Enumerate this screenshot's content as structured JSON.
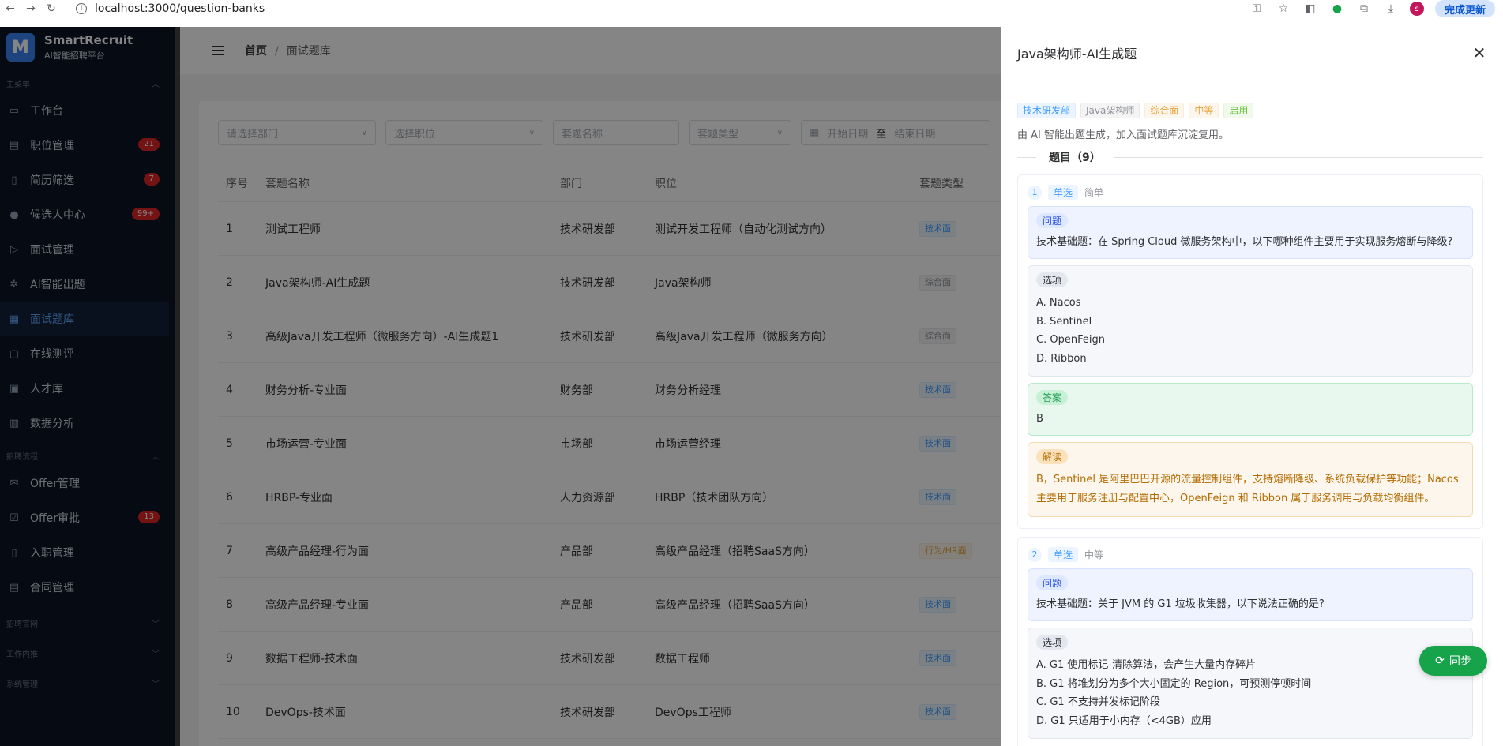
{
  "browser": {
    "url": "localhost:3000/question-banks",
    "update_label": "完成更新",
    "avatar_letter": "s"
  },
  "sidebar": {
    "brand": "SmartRecruit",
    "brand_sub": "AI智能招聘平台",
    "logo_letter": "M",
    "groups": [
      {
        "label": "主菜单"
      },
      {
        "label": "招聘流程"
      },
      {
        "label": "招聘官网"
      },
      {
        "label": "工作内推"
      },
      {
        "label": "系统管理"
      }
    ],
    "items": [
      {
        "label": "工作台",
        "badge": ""
      },
      {
        "label": "职位管理",
        "badge": "21"
      },
      {
        "label": "简历筛选",
        "badge": "7"
      },
      {
        "label": "候选人中心",
        "badge": "99+"
      },
      {
        "label": "面试管理",
        "badge": ""
      },
      {
        "label": "AI智能出题",
        "badge": ""
      },
      {
        "label": "面试题库",
        "badge": ""
      },
      {
        "label": "在线测评",
        "badge": ""
      },
      {
        "label": "人才库",
        "badge": ""
      },
      {
        "label": "数据分析",
        "badge": ""
      },
      {
        "label": "Offer管理",
        "badge": ""
      },
      {
        "label": "Offer审批",
        "badge": "13"
      },
      {
        "label": "入职管理",
        "badge": ""
      },
      {
        "label": "合同管理",
        "badge": ""
      }
    ]
  },
  "main": {
    "breadcrumb_home": "首页",
    "breadcrumb_current": "面试题库",
    "filters": {
      "department": "请选择部门",
      "position": "选择职位",
      "name": "套题名称",
      "type": "套题类型",
      "start_date": "开始日期",
      "to": "至",
      "end_date": "结束日期"
    },
    "columns": [
      "序号",
      "套题名称",
      "部门",
      "职位",
      "套题类型"
    ],
    "rows": [
      {
        "no": "1",
        "name": "测试工程师",
        "dept": "技术研发部",
        "position": "测试开发工程师（自动化测试方向）",
        "type": "技术面",
        "tone": "blue"
      },
      {
        "no": "2",
        "name": "Java架构师-AI生成题",
        "dept": "技术研发部",
        "position": "Java架构师",
        "type": "综合面",
        "tone": "gray"
      },
      {
        "no": "3",
        "name": "高级Java开发工程师（微服务方向）-AI生成题1",
        "dept": "技术研发部",
        "position": "高级Java开发工程师（微服务方向）",
        "type": "综合面",
        "tone": "gray"
      },
      {
        "no": "4",
        "name": "财务分析-专业面",
        "dept": "财务部",
        "position": "财务分析经理",
        "type": "技术面",
        "tone": "blue"
      },
      {
        "no": "5",
        "name": "市场运营-专业面",
        "dept": "市场部",
        "position": "市场运营经理",
        "type": "技术面",
        "tone": "blue"
      },
      {
        "no": "6",
        "name": "HRBP-专业面",
        "dept": "人力资源部",
        "position": "HRBP（技术团队方向）",
        "type": "技术面",
        "tone": "blue"
      },
      {
        "no": "7",
        "name": "高级产品经理-行为面",
        "dept": "产品部",
        "position": "高级产品经理（招聘SaaS方向）",
        "type": "行为/HR面",
        "tone": "orange"
      },
      {
        "no": "8",
        "name": "高级产品经理-专业面",
        "dept": "产品部",
        "position": "高级产品经理（招聘SaaS方向）",
        "type": "技术面",
        "tone": "blue"
      },
      {
        "no": "9",
        "name": "数据工程师-技术面",
        "dept": "技术研发部",
        "position": "数据工程师",
        "type": "技术面",
        "tone": "blue"
      },
      {
        "no": "10",
        "name": "DevOps-技术面",
        "dept": "技术研发部",
        "position": "DevOps工程师",
        "type": "技术面",
        "tone": "blue"
      }
    ]
  },
  "drawer": {
    "title": "Java架构师-AI生成题",
    "tags": [
      {
        "label": "技术研发部",
        "tone": "blue"
      },
      {
        "label": "Java架构师",
        "tone": "gray"
      },
      {
        "label": "综合面",
        "tone": "orange"
      },
      {
        "label": "中等",
        "tone": "orange"
      },
      {
        "label": "启用",
        "tone": "green"
      }
    ],
    "description": "由 AI 智能出题生成，加入面试题库沉淀复用。",
    "questions_heading": "题目（9）",
    "section_labels": {
      "question": "问题",
      "options": "选项",
      "answer": "答案",
      "explanation": "解读"
    },
    "questions": [
      {
        "num": "1",
        "type": "单选",
        "level": "简单",
        "text": "技术基础题：在 Spring Cloud 微服务架构中，以下哪种组件主要用于实现服务熔断与降级?",
        "options": [
          "A. Nacos",
          "B. Sentinel",
          "C. OpenFeign",
          "D. Ribbon"
        ],
        "answer": "B",
        "explanation": "B，Sentinel 是阿里巴巴开源的流量控制组件，支持熔断降级、系统负载保护等功能；Nacos 主要用于服务注册与配置中心，OpenFeign 和 Ribbon 属于服务调用与负载均衡组件。"
      },
      {
        "num": "2",
        "type": "单选",
        "level": "中等",
        "text": "技术基础题：关于 JVM 的 G1 垃圾收集器，以下说法正确的是?",
        "options": [
          "A. G1 使用标记-清除算法，会产生大量内存碎片",
          "B. G1 将堆划分为多个大小固定的 Region，可预测停顿时间",
          "C. G1 不支持并发标记阶段",
          "D. G1 只适用于小内存（<4GB）应用"
        ]
      }
    ],
    "sync_label": "同步"
  }
}
